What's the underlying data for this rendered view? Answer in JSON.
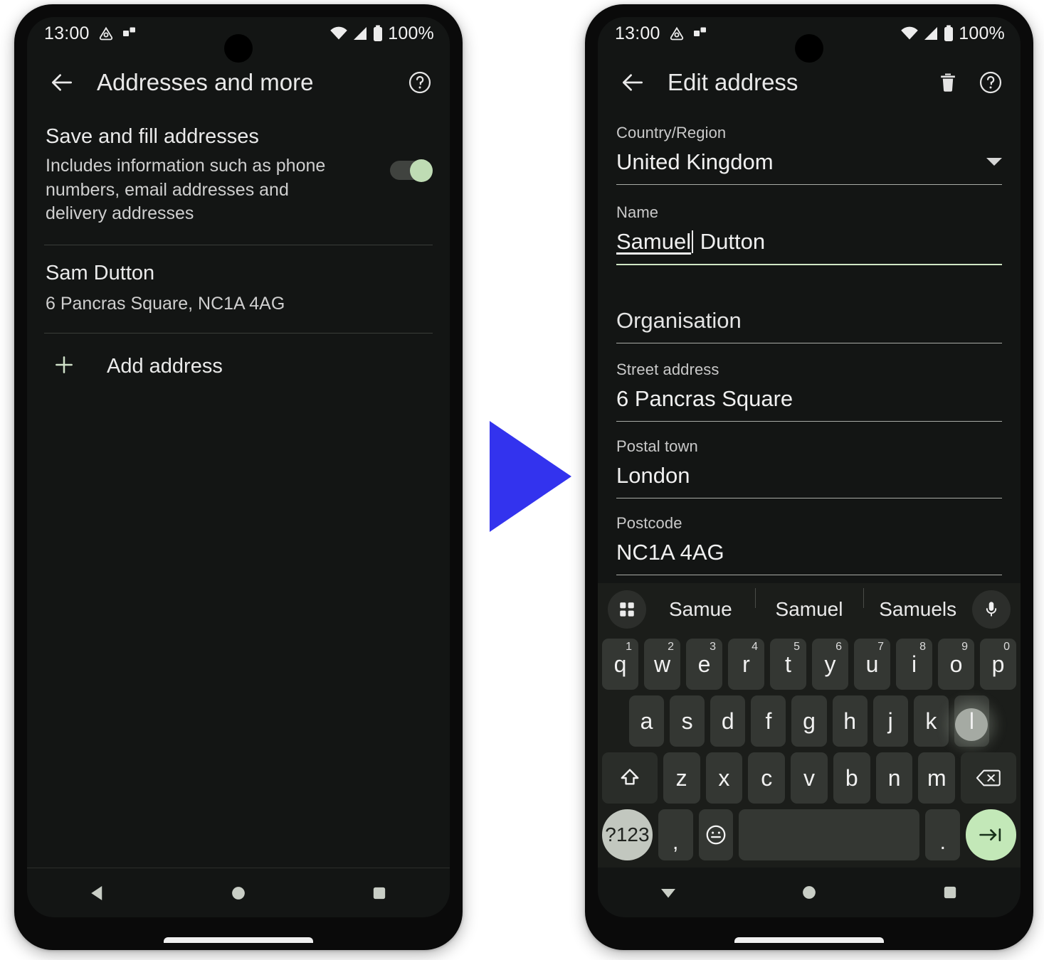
{
  "status_bar": {
    "time": "13:00",
    "battery_percent": "100%",
    "icons": [
      "driving-mode-icon",
      "cast-icon",
      "wifi-icon",
      "signal-icon",
      "battery-icon"
    ]
  },
  "left_phone": {
    "appbar": {
      "back": "back-arrow-icon",
      "title": "Addresses and more",
      "help": "help-icon"
    },
    "setting": {
      "title": "Save and fill addresses",
      "subtitle": "Includes information such as phone numbers, email addresses and delivery addresses",
      "toggle_state": "on"
    },
    "saved_address": {
      "name": "Sam Dutton",
      "address": "6 Pancras Square, NC1A 4AG"
    },
    "add_address_label": "Add address",
    "nav": [
      "back-triangle-icon",
      "home-circle-icon",
      "recents-square-icon"
    ]
  },
  "right_phone": {
    "appbar": {
      "back": "back-arrow-icon",
      "title": "Edit address",
      "delete": "trash-icon",
      "help": "help-icon"
    },
    "fields": [
      {
        "label": "Country/Region",
        "value": "United Kingdom",
        "type": "dropdown",
        "focused": false
      },
      {
        "label": "Name",
        "value": "Samuel Dutton",
        "composing": "Samuel",
        "rest": " Dutton",
        "type": "text",
        "focused": true
      },
      {
        "label": "",
        "value": "Organisation",
        "type": "text",
        "focused": false
      },
      {
        "label": "Street address",
        "value": "6 Pancras Square",
        "type": "text",
        "focused": false
      },
      {
        "label": "Postal town",
        "value": "London",
        "type": "text",
        "focused": false
      },
      {
        "label": "Postcode",
        "value": "NC1A 4AG",
        "type": "text",
        "focused": false
      }
    ],
    "keyboard": {
      "suggestions": [
        "Samue",
        "Samuel",
        "Samuels"
      ],
      "left_icon": "apps-grid-icon",
      "right_icon": "microphone-icon",
      "row1": [
        {
          "k": "q",
          "n": "1"
        },
        {
          "k": "w",
          "n": "2"
        },
        {
          "k": "e",
          "n": "3"
        },
        {
          "k": "r",
          "n": "4"
        },
        {
          "k": "t",
          "n": "5"
        },
        {
          "k": "y",
          "n": "6"
        },
        {
          "k": "u",
          "n": "7"
        },
        {
          "k": "i",
          "n": "8"
        },
        {
          "k": "o",
          "n": "9"
        },
        {
          "k": "p",
          "n": "0"
        }
      ],
      "row2": [
        {
          "k": "a"
        },
        {
          "k": "s"
        },
        {
          "k": "d"
        },
        {
          "k": "f"
        },
        {
          "k": "g"
        },
        {
          "k": "h"
        },
        {
          "k": "j"
        },
        {
          "k": "k"
        },
        {
          "k": "l",
          "pressed": true
        }
      ],
      "row3_shift": "shift-icon",
      "row3": [
        {
          "k": "z"
        },
        {
          "k": "x"
        },
        {
          "k": "c"
        },
        {
          "k": "v"
        },
        {
          "k": "b"
        },
        {
          "k": "n"
        },
        {
          "k": "m"
        }
      ],
      "row3_backspace": "backspace-icon",
      "row4": {
        "symbols": "?123",
        "comma": ",",
        "emoji": "emoji-icon",
        "space": "",
        "period": ".",
        "enter": "next-field-icon"
      }
    },
    "nav": [
      "keyboard-dismiss-icon",
      "home-circle-icon",
      "recents-square-icon"
    ]
  },
  "flow_arrow": {
    "name": "flow-arrow",
    "color": "#3333ee"
  }
}
